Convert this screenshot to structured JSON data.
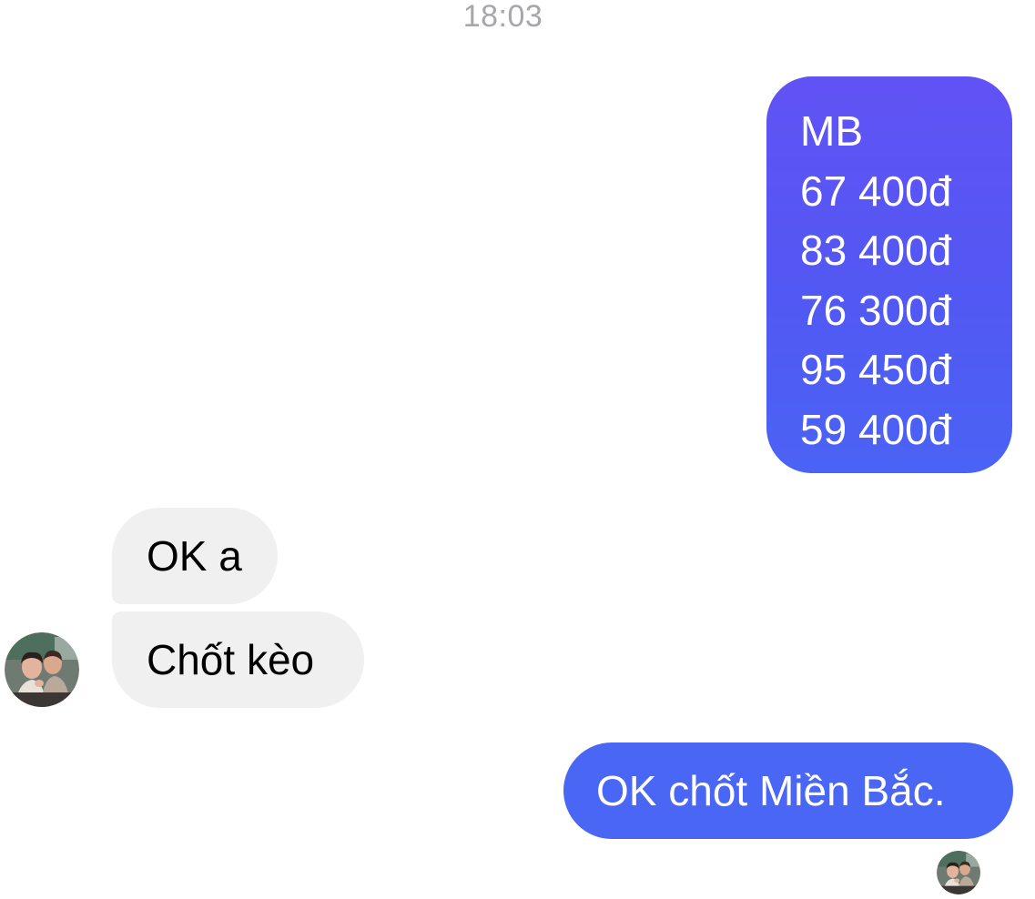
{
  "conversation": {
    "timestamp": "18:03",
    "messages": [
      {
        "direction": "outgoing",
        "lines": [
          "MB",
          "67 400đ",
          "83 400đ",
          "76 300đ",
          "95 450đ",
          "59 400đ"
        ]
      },
      {
        "direction": "incoming",
        "text": "OK a"
      },
      {
        "direction": "incoming",
        "text": "Chốt kèo"
      },
      {
        "direction": "outgoing",
        "text": "OK chốt Miền Bắc."
      }
    ],
    "colors": {
      "outgoing_bubble_top": "#6152f4",
      "outgoing_bubble_bottom": "#4a63f5",
      "incoming_bubble": "#f0f0f0",
      "timestamp_text": "#a7a7ab"
    }
  },
  "icons": {
    "sender_avatar": "contact-avatar-photo",
    "seen_indicator": "read-receipt-avatar-photo"
  }
}
